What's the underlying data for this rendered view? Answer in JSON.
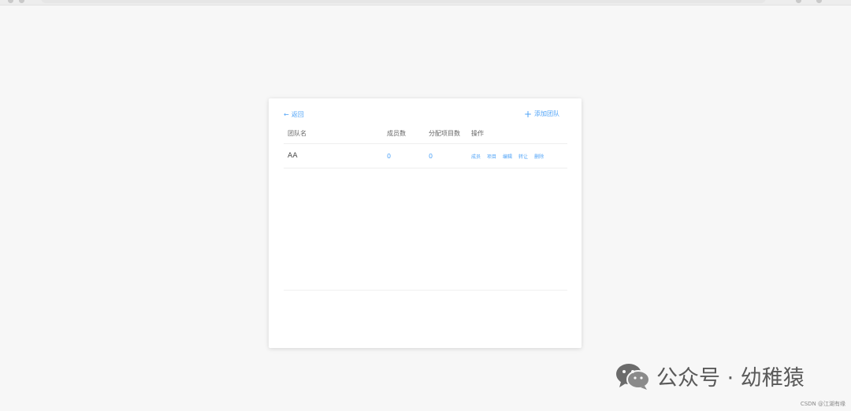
{
  "back_label": "返回",
  "add_team_label": "添加团队",
  "table": {
    "headers": [
      "团队名",
      "成员数",
      "分配项目数",
      "操作"
    ],
    "rows": [
      {
        "name": "AA",
        "members": "0",
        "projects": "0",
        "actions": [
          "成员",
          "项目",
          "编辑",
          "转让",
          "删除"
        ]
      }
    ]
  },
  "watermark": {
    "text": "公众号 · 幼稚猿"
  },
  "credit": "CSDN @江湖有缘",
  "colors": {
    "accent": "#4fa3f7",
    "background": "#f7f7f7",
    "card": "#ffffff"
  }
}
